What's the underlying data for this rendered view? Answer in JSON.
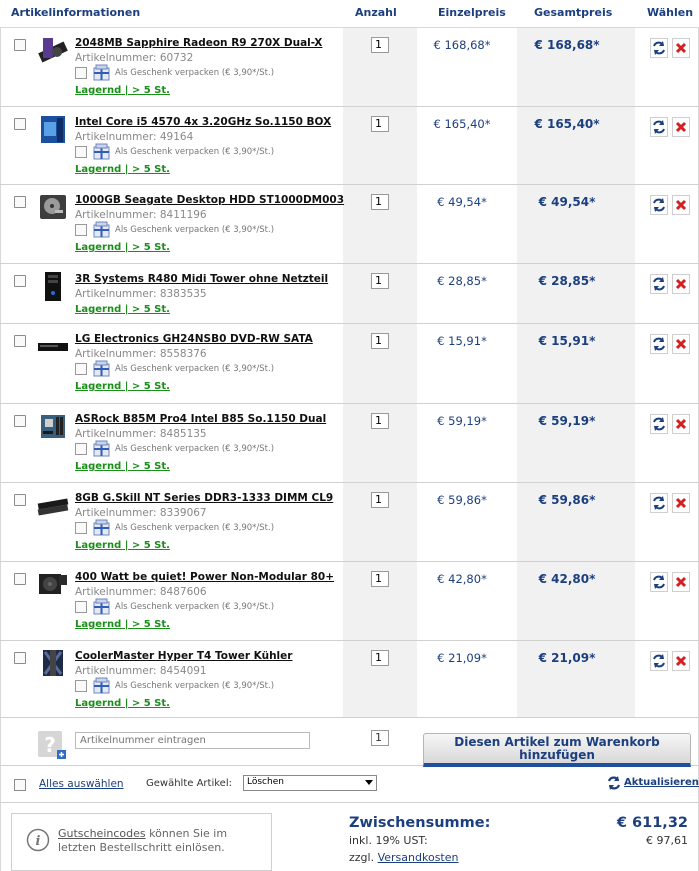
{
  "header": {
    "col_article": "Artikelinformationen",
    "col_qty": "Anzahl",
    "col_unit": "Einzelpreis",
    "col_total": "Gesamtpreis",
    "col_select": "Wählen"
  },
  "items": [
    {
      "name": "2048MB Sapphire Radeon R9 270X Dual-X",
      "artnr": "Artikelnummer: 60732",
      "gift": "Als Geschenk verpacken (€ 3,90*/St.)",
      "stock": "Lagernd | > 5 St.",
      "qty": "1",
      "unit_price": "€ 168,68*",
      "total_price": "€ 168,68*",
      "thumb": "graphics-card-icon"
    },
    {
      "name": "Intel Core i5 4570 4x 3.20GHz So.1150 BOX",
      "artnr": "Artikelnummer: 49164",
      "gift": "Als Geschenk verpacken (€ 3,90*/St.)",
      "stock": "Lagernd | > 5 St.",
      "qty": "1",
      "unit_price": "€ 165,40*",
      "total_price": "€ 165,40*",
      "thumb": "cpu-box-icon"
    },
    {
      "name": "1000GB Seagate Desktop HDD ST1000DM003",
      "artnr": "Artikelnummer: 8411196",
      "gift": "Als Geschenk verpacken (€ 3,90*/St.)",
      "stock": "Lagernd | > 5 St.",
      "qty": "1",
      "unit_price": "€ 49,54*",
      "total_price": "€ 49,54*",
      "thumb": "hdd-icon"
    },
    {
      "name": "3R Systems R480 Midi Tower ohne Netzteil",
      "artnr": "Artikelnummer: 8383535",
      "gift": "",
      "stock": "Lagernd | > 5 St.",
      "qty": "1",
      "unit_price": "€ 28,85*",
      "total_price": "€ 28,85*",
      "thumb": "tower-case-icon"
    },
    {
      "name": "LG Electronics GH24NSB0 DVD-RW SATA",
      "artnr": "Artikelnummer: 8558376",
      "gift": "Als Geschenk verpacken (€ 3,90*/St.)",
      "stock": "Lagernd | > 5 St.",
      "qty": "1",
      "unit_price": "€ 15,91*",
      "total_price": "€ 15,91*",
      "thumb": "dvd-drive-icon"
    },
    {
      "name": "ASRock B85M Pro4 Intel B85 So.1150 Dual",
      "artnr": "Artikelnummer: 8485135",
      "gift": "Als Geschenk verpacken (€ 3,90*/St.)",
      "stock": "Lagernd | > 5 St.",
      "qty": "1",
      "unit_price": "€ 59,19*",
      "total_price": "€ 59,19*",
      "thumb": "mainboard-icon"
    },
    {
      "name": "8GB G.Skill NT Series DDR3-1333 DIMM CL9",
      "artnr": "Artikelnummer: 8339067",
      "gift": "Als Geschenk verpacken (€ 3,90*/St.)",
      "stock": "Lagernd | > 5 St.",
      "qty": "1",
      "unit_price": "€ 59,86*",
      "total_price": "€ 59,86*",
      "thumb": "ram-icon"
    },
    {
      "name": "400 Watt be quiet! Power Non-Modular 80+",
      "artnr": "Artikelnummer: 8487606",
      "gift": "Als Geschenk verpacken (€ 3,90*/St.)",
      "stock": "Lagernd | > 5 St.",
      "qty": "1",
      "unit_price": "€ 42,80*",
      "total_price": "€ 42,80*",
      "thumb": "psu-icon"
    },
    {
      "name": "CoolerMaster Hyper T4 Tower Kühler",
      "artnr": "Artikelnummer: 8454091",
      "gift": "Als Geschenk verpacken (€ 3,90*/St.)",
      "stock": "Lagernd | > 5 St.",
      "qty": "1",
      "unit_price": "€ 21,09*",
      "total_price": "€ 21,09*",
      "thumb": "cpu-cooler-icon"
    }
  ],
  "add_row": {
    "placeholder": "Artikelnummer eintragen",
    "qty": "1",
    "button_label": "Diesen Artikel zum Warenkorb hinzufügen"
  },
  "bottom_bar": {
    "select_all": "Alles auswählen",
    "selected_label": "Gewählte Artikel:",
    "action_value": "Löschen",
    "refresh": "Aktualisieren"
  },
  "coupon": {
    "link": "Gutscheincodes",
    "text": " können Sie im letzten Bestellschritt einlösen."
  },
  "summary": {
    "subtotal_label": "Zwischensumme:",
    "subtotal_value": "€ 611,32",
    "vat_label": "inkl. 19% UST:",
    "vat_value": "€ 97,61",
    "shipping_prefix": "zzgl. ",
    "shipping_link": "Versandkosten"
  },
  "colors": {
    "accent_blue": "#1c3f7f",
    "stock_green": "#1a8f1a",
    "delete_red": "#d42020"
  }
}
